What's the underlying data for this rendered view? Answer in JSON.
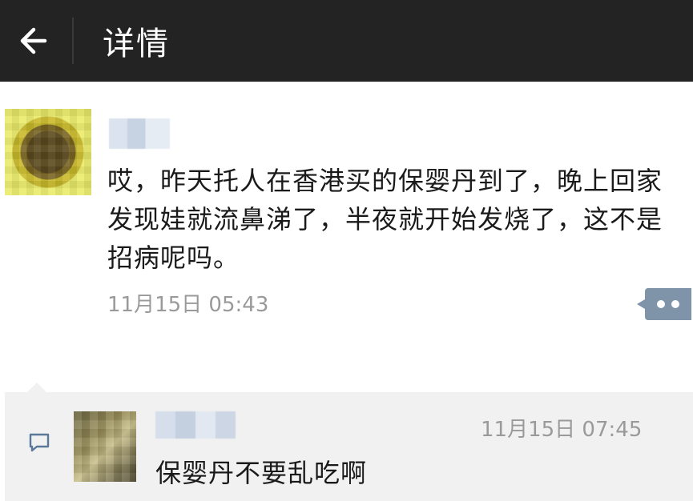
{
  "header": {
    "title": "详情",
    "back_icon": "arrow-left-icon"
  },
  "post": {
    "avatar_icon": "avatar",
    "content": "哎，昨天托人在香港买的保婴丹到了，晚上回家发现娃就流鼻涕了，半夜就开始发烧了，这不是招病呢吗。",
    "timestamp": "11月15日 05:43",
    "more_icon": "comment-dots-icon"
  },
  "comments": [
    {
      "timestamp": "11月15日 07:45",
      "text": "保婴丹不要乱吃啊"
    }
  ],
  "colors": {
    "header_bg": "#232323",
    "comment_bg": "#f1f1f1",
    "accent": "#7f93a9"
  }
}
